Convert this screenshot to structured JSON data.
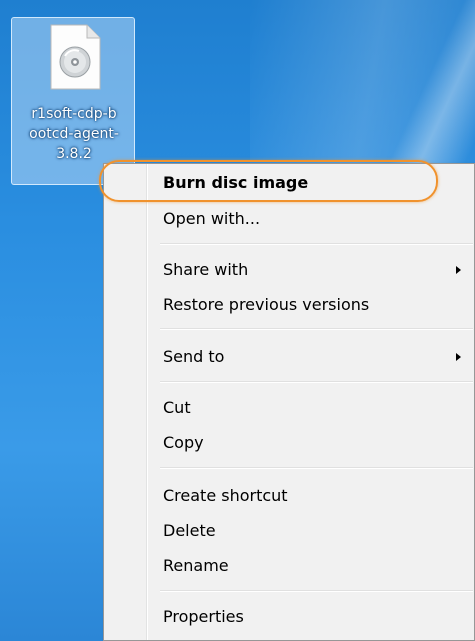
{
  "desktop": {
    "file_icon": {
      "label": "r1soft-cdp-b\nootcd-agent-\n3.8.2",
      "icon": "disc-image-file-icon"
    }
  },
  "context_menu": {
    "items": [
      {
        "label": "Burn disc image",
        "default": true
      },
      {
        "label": "Open with..."
      },
      {
        "label": "Share with",
        "submenu": true
      },
      {
        "label": "Restore previous versions"
      },
      {
        "label": "Send to",
        "submenu": true
      },
      {
        "label": "Cut"
      },
      {
        "label": "Copy"
      },
      {
        "label": "Create shortcut"
      },
      {
        "label": "Delete"
      },
      {
        "label": "Rename"
      },
      {
        "label": "Properties"
      }
    ]
  },
  "colors": {
    "highlight_ring": "#f0922d",
    "desktop_blue": "#2a8ee0",
    "menu_background": "#f1f1f1"
  }
}
